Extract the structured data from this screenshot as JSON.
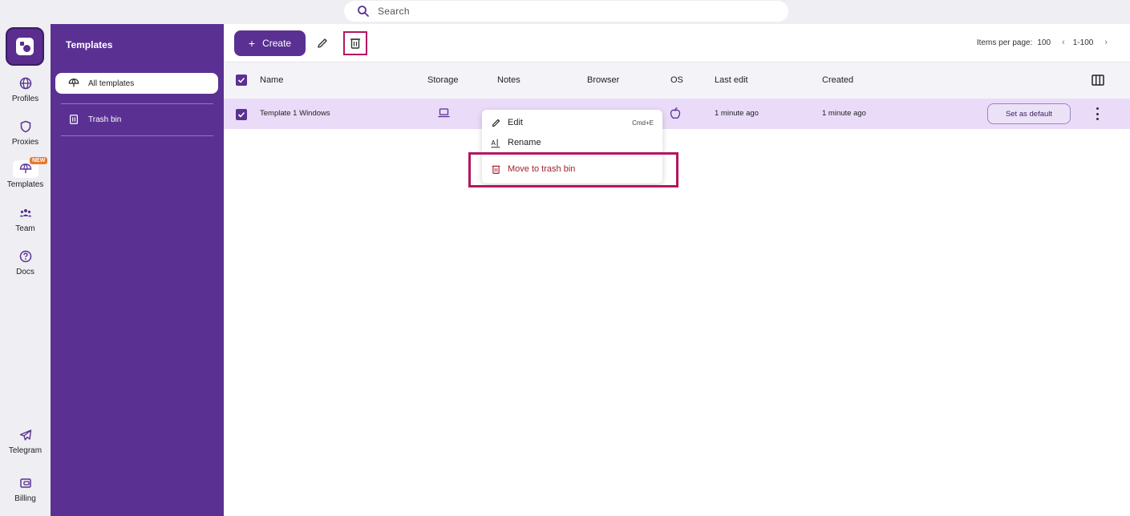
{
  "search": {
    "placeholder": "Search"
  },
  "rail": {
    "items": [
      {
        "label": "Profiles",
        "icon": "globe-icon"
      },
      {
        "label": "Proxies",
        "icon": "shield-icon"
      },
      {
        "label": "Templates",
        "icon": "umbrella-icon",
        "badge": "NEW"
      },
      {
        "label": "Team",
        "icon": "team-icon"
      },
      {
        "label": "Docs",
        "icon": "question-icon"
      },
      {
        "label": "Telegram",
        "icon": "telegram-icon"
      },
      {
        "label": "Billing",
        "icon": "wallet-icon"
      }
    ]
  },
  "sidebar": {
    "title": "Templates",
    "items": [
      {
        "label": "All templates",
        "icon": "umbrella-icon"
      },
      {
        "label": "Trash bin",
        "icon": "trash-icon"
      }
    ]
  },
  "toolbar": {
    "create_label": "Create",
    "items_per_page_label": "Items per page:",
    "items_per_page_value": "100",
    "range": "1-100"
  },
  "table": {
    "headers": [
      "Name",
      "Storage",
      "Notes",
      "Browser",
      "OS",
      "Last edit",
      "Created"
    ],
    "rows": [
      {
        "name": "Template 1 Windows",
        "last_edit": "1 minute ago",
        "created": "1 minute ago",
        "action": "Set as default"
      }
    ]
  },
  "context_menu": {
    "items": [
      {
        "label": "Edit",
        "shortcut": "Cmd+E"
      },
      {
        "label": "Rename"
      },
      {
        "label": "Move to trash bin"
      }
    ]
  },
  "colors": {
    "accent": "#5a3192",
    "highlight": "#b3175f",
    "row_selected": "#eadcf9",
    "danger": "#a3222e"
  }
}
